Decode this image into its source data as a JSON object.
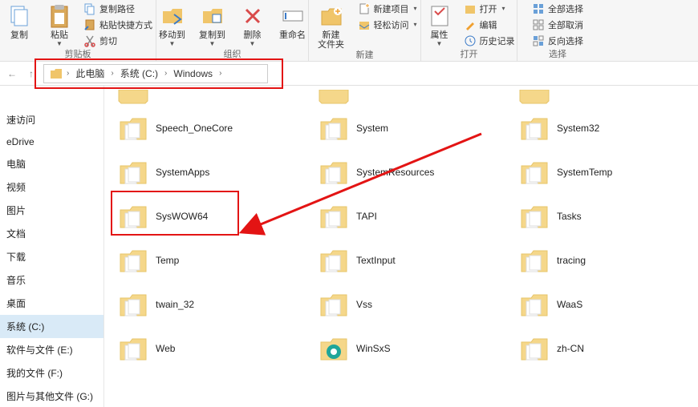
{
  "ribbon": {
    "groups": [
      {
        "label": "剪贴板",
        "big": [
          {
            "label": "复制",
            "icon": "copy-icon"
          },
          {
            "label": "粘贴",
            "icon": "paste-icon"
          }
        ],
        "small": [
          {
            "label": "复制路径",
            "icon": "copypath-icon"
          },
          {
            "label": "粘贴快捷方式",
            "icon": "pasteshortcut-icon"
          },
          {
            "label": "剪切",
            "icon": "cut-icon"
          }
        ]
      },
      {
        "label": "组织",
        "big": [
          {
            "label": "移动到",
            "icon": "moveto-icon"
          },
          {
            "label": "复制到",
            "icon": "copyto-icon"
          },
          {
            "label": "删除",
            "icon": "delete-icon"
          },
          {
            "label": "重命名",
            "icon": "rename-icon"
          }
        ]
      },
      {
        "label": "新建",
        "big": [
          {
            "label": "新建\n文件夹",
            "icon": "newfolder-icon"
          }
        ],
        "small": [
          {
            "label": "新建项目",
            "icon": "newitem-icon"
          },
          {
            "label": "轻松访问",
            "icon": "easyaccess-icon"
          }
        ]
      },
      {
        "label": "打开",
        "big": [
          {
            "label": "属性",
            "icon": "properties-icon"
          }
        ],
        "small": [
          {
            "label": "打开",
            "icon": "open-icon"
          },
          {
            "label": "编辑",
            "icon": "edit-icon"
          },
          {
            "label": "历史记录",
            "icon": "history-icon"
          }
        ]
      },
      {
        "label": "选择",
        "small": [
          {
            "label": "全部选择",
            "icon": "selectall-icon"
          },
          {
            "label": "全部取消",
            "icon": "selectnone-icon"
          },
          {
            "label": "反向选择",
            "icon": "invertsel-icon"
          }
        ]
      }
    ]
  },
  "breadcrumb": {
    "items": [
      "此电脑",
      "系统 (C:)",
      "Windows"
    ]
  },
  "sidebar": {
    "items": [
      {
        "label": "速访问"
      },
      {
        "label": "eDrive"
      },
      {
        "label": "电脑"
      },
      {
        "label": "视频"
      },
      {
        "label": "图片"
      },
      {
        "label": "文档"
      },
      {
        "label": "下载"
      },
      {
        "label": "音乐"
      },
      {
        "label": "桌面"
      },
      {
        "label": "系统 (C:)",
        "selected": true
      },
      {
        "label": "软件与文件 (E:)"
      },
      {
        "label": "我的文件 (F:)"
      },
      {
        "label": "图片与其他文件 (G:)"
      }
    ]
  },
  "folders": [
    {
      "name": "",
      "top": true
    },
    {
      "name": "",
      "top": true
    },
    {
      "name": "",
      "top": true
    },
    {
      "name": "Speech_OneCore"
    },
    {
      "name": "System"
    },
    {
      "name": "System32"
    },
    {
      "name": "SystemApps"
    },
    {
      "name": "SystemResources"
    },
    {
      "name": "SystemTemp"
    },
    {
      "name": "SysWOW64",
      "highlight": true
    },
    {
      "name": "TAPI"
    },
    {
      "name": "Tasks"
    },
    {
      "name": "Temp"
    },
    {
      "name": "TextInput"
    },
    {
      "name": "tracing"
    },
    {
      "name": "twain_32"
    },
    {
      "name": "Vss"
    },
    {
      "name": "WaaS"
    },
    {
      "name": "Web"
    },
    {
      "name": "WinSxS",
      "special": true
    },
    {
      "name": "zh-CN"
    }
  ],
  "annotations": {
    "arrow_color": "#e31414"
  }
}
